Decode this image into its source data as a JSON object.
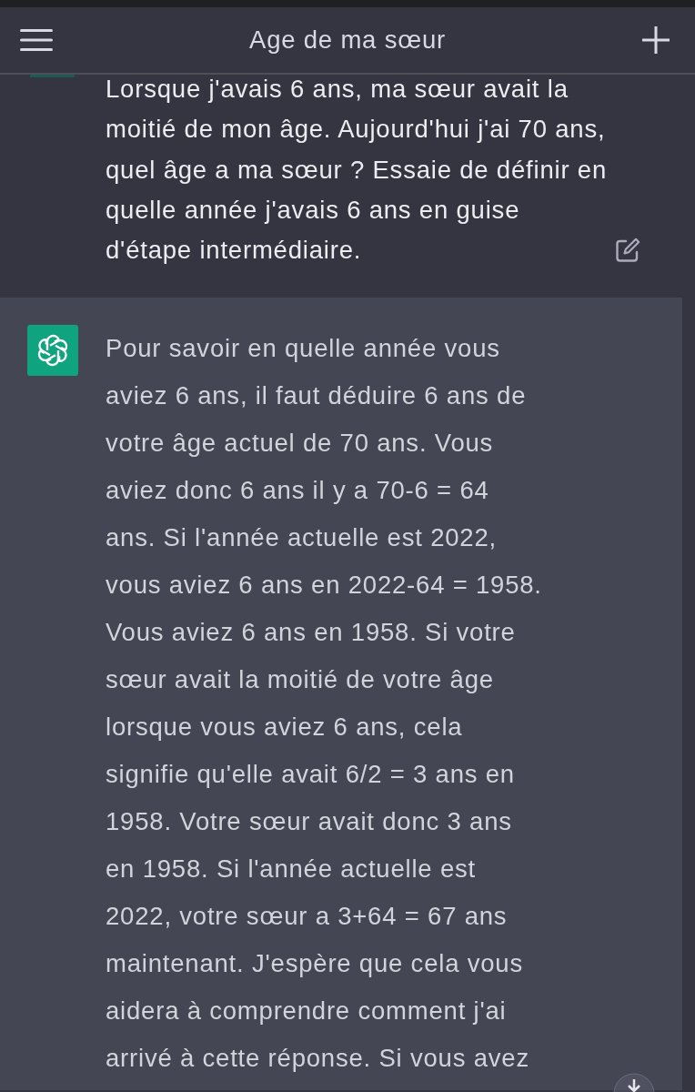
{
  "header": {
    "title": "Age de ma sœur"
  },
  "messages": [
    {
      "kind": "user",
      "lines": [
        "Lorsque j'avais 6 ans, ma sœur avait la",
        "moitié de mon âge. Aujourd'hui j'ai 70 ans,",
        "quel âge a ma sœur ? Essaie de définir en",
        "quelle année j'avais 6 ans en guise",
        "d'étape intermédiaire."
      ]
    },
    {
      "kind": "assistant",
      "lines": [
        "Pour savoir en quelle année vous",
        "aviez 6 ans, il faut déduire 6 ans de",
        "votre âge actuel de 70 ans. Vous",
        "aviez donc 6 ans il y a 70-6 = 64",
        "ans. Si l'année actuelle est 2022,",
        "vous aviez 6 ans en 2022-64 = 1958.",
        "Vous aviez 6 ans en 1958. Si votre",
        "sœur avait la moitié de votre âge",
        "lorsque vous aviez 6 ans, cela",
        "signifie qu'elle avait 6/2 = 3 ans en",
        "1958. Votre sœur avait donc 3 ans",
        "en 1958. Si l'année actuelle est",
        "2022, votre sœur a 3+64 = 67 ans",
        "maintenant. J'espère que cela vous",
        "aidera à comprendre comment j'ai",
        "arrivé à cette réponse. Si vous avez"
      ]
    }
  ]
}
